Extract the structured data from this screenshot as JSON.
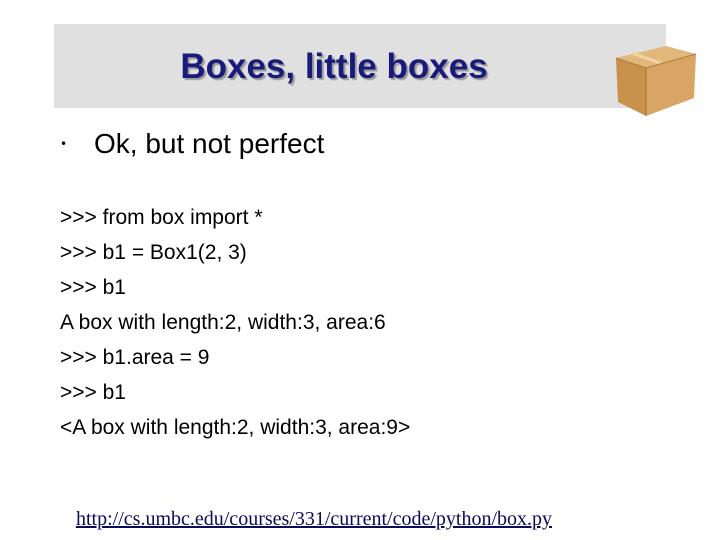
{
  "slide": {
    "title": "Boxes, little boxes",
    "bullet_symbol": "•",
    "bullet_text": "Ok, but not perfect",
    "code_lines": [
      ">>> from box import *",
      ">>> b1 = Box1(2, 3)",
      ">>> b1",
      "A box with length:2, width:3, area:6",
      ">>> b1.area = 9",
      ">>> b1",
      "<A box with length:2, width:3, area:9>"
    ],
    "link": "http://cs.umbc.edu/courses/331/current/code/python/box.py"
  },
  "icons": {
    "title_icon": "cardboard-box-icon"
  },
  "colors": {
    "title": "#1a1a7a",
    "title_band": "#e0e0e0",
    "link": "#0a0a5a"
  }
}
